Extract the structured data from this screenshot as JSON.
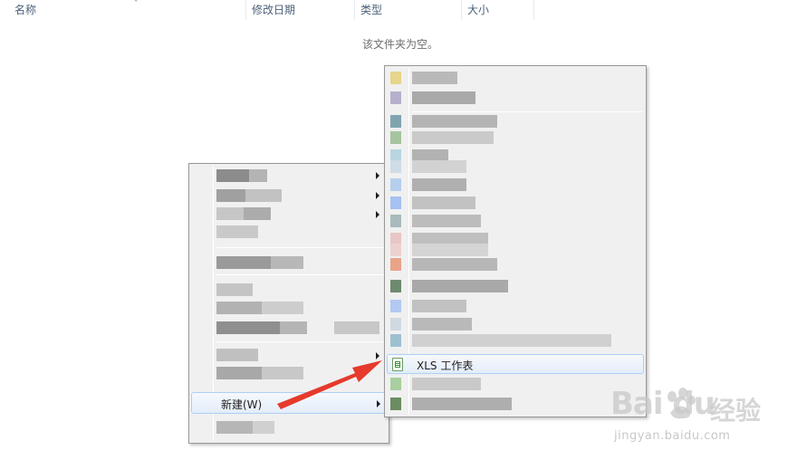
{
  "columns": {
    "name": "名称",
    "date_modified": "修改日期",
    "type": "类型",
    "size": "大小"
  },
  "empty_message": "该文件夹为空。",
  "context_menu": {
    "new_item_label": "新建(W)"
  },
  "submenu": {
    "xls_item_label": "XLS 工作表"
  },
  "icons": {
    "xls_item": "spreadsheet-file-icon",
    "submenu_arrow": "chevron-right-icon"
  },
  "colors": {
    "highlight_border": "#aecff7",
    "annotation_arrow": "#e53a2c",
    "menu_background": "#f0f0f0"
  },
  "watermark": {
    "brand": "Bai du",
    "site_cn": "经验",
    "url": "jingyan.baidu.com"
  }
}
